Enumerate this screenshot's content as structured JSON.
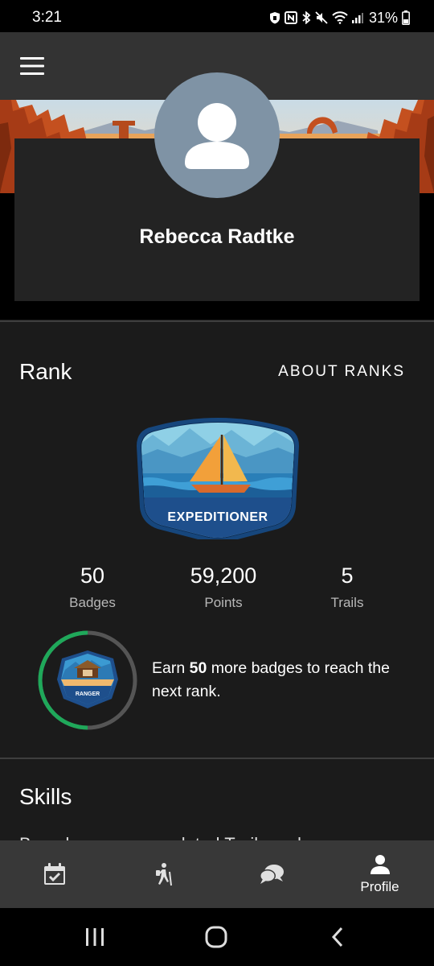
{
  "status_bar": {
    "time": "3:21",
    "battery": "31%",
    "icons": [
      "shield-icon",
      "nfc-icon",
      "bluetooth-icon",
      "mute-icon",
      "wifi-icon",
      "signal-icon",
      "battery-icon"
    ]
  },
  "app_bar": {
    "menu_icon": "hamburger-menu-icon"
  },
  "profile": {
    "name": "Rebecca Radtke",
    "avatar_icon": "person-avatar-icon"
  },
  "rank": {
    "title": "Rank",
    "about_link": "ABOUT RANKS",
    "badge_name": "EXPEDITIONER",
    "stats": [
      {
        "value": "50",
        "label": "Badges"
      },
      {
        "value": "59,200",
        "label": "Points"
      },
      {
        "value": "5",
        "label": "Trails"
      }
    ],
    "next_rank": {
      "badge_name": "RANGER",
      "progress": 0.5,
      "text_before": "Earn ",
      "count": "50",
      "text_after": " more badges to reach the next rank."
    }
  },
  "skills": {
    "title": "Skills",
    "description": "Based on your completed Trails and"
  },
  "bottom_nav": {
    "items": [
      {
        "icon": "calendar-check-icon",
        "label": ""
      },
      {
        "icon": "hiker-icon",
        "label": ""
      },
      {
        "icon": "chat-bubbles-icon",
        "label": ""
      },
      {
        "icon": "person-icon",
        "label": "Profile"
      }
    ]
  },
  "colors": {
    "app_bar": "#333333",
    "card": "#232323",
    "progress": "#1fa85a",
    "badge_blue": "#1e4f8c"
  }
}
